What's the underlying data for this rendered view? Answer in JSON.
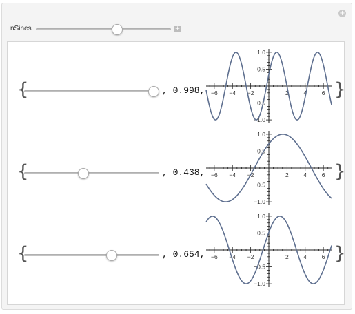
{
  "header": {
    "control_label": "nSines",
    "expand_glyph": "+",
    "corner_glyph": "+"
  },
  "nsines": {
    "value_fraction": 0.6
  },
  "colors": {
    "curve": "#5E6F8F",
    "axis": "#222222",
    "panel": "#f4f4f4"
  },
  "icons": [
    "add-icon",
    "expand-icon"
  ],
  "rows": [
    {
      "open_brace": "{",
      "close_brace": "}",
      "text": ", 0.998,",
      "value": 0.998,
      "slider_fraction": 0.96,
      "amplitude": 1.0,
      "frequency": 1.4,
      "phase": 0.35
    },
    {
      "open_brace": "{",
      "close_brace": "}",
      "text": ", 0.438,",
      "value": 0.438,
      "slider_fraction": 0.44,
      "amplitude": 1.0,
      "frequency": 0.5,
      "phase": 0.8
    },
    {
      "open_brace": "{",
      "close_brace": "}",
      "text": ", 0.654,",
      "value": 0.654,
      "slider_fraction": 0.65,
      "amplitude": 1.0,
      "frequency": 0.85,
      "phase": 0.55
    }
  ],
  "plot": {
    "xlim": [
      -6.9,
      6.9
    ],
    "ylim": [
      -1.1,
      1.1
    ],
    "x_ticks": [
      -6,
      -4,
      -2,
      2,
      4,
      6
    ],
    "x_tick_labels": [
      "−6",
      "−4",
      "−2",
      "2",
      "4",
      "6"
    ],
    "y_ticks": [
      1.0,
      0.5,
      -0.5,
      -1.0
    ],
    "y_tick_labels": [
      "1.0",
      "0.5",
      "−0.5",
      "−1.0"
    ]
  }
}
